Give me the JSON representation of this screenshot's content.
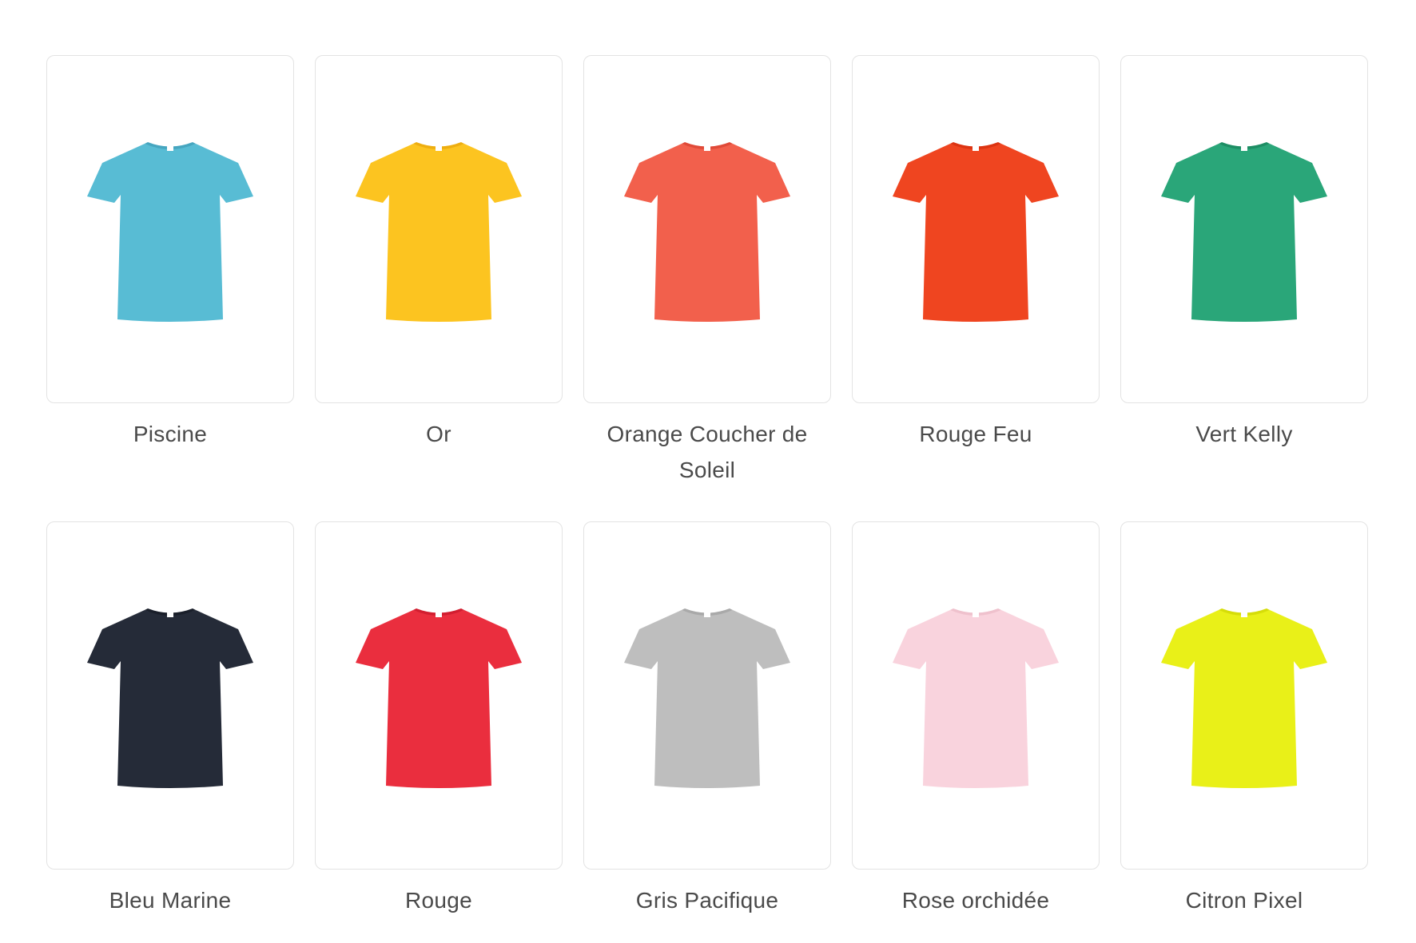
{
  "swatches": [
    {
      "label": "Piscine",
      "color": "#58bcd4",
      "shade": "#46a6c0"
    },
    {
      "label": "Or",
      "color": "#fcc420",
      "shade": "#eeae10"
    },
    {
      "label": "Orange Coucher de Soleil",
      "color": "#f2604c",
      "shade": "#e04a38"
    },
    {
      "label": "Rouge Feu",
      "color": "#ef4520",
      "shade": "#dc3412"
    },
    {
      "label": "Vert Kelly",
      "color": "#2aa679",
      "shade": "#1d8e64"
    },
    {
      "label": "Bleu Marine",
      "color": "#252b38",
      "shade": "#1a1f2a"
    },
    {
      "label": "Rouge",
      "color": "#ea2e3e",
      "shade": "#d21e30"
    },
    {
      "label": "Gris Pacifique",
      "color": "#bebebe",
      "shade": "#a9a9a9"
    },
    {
      "label": "Rose orchidée",
      "color": "#f9d3dd",
      "shade": "#efc1cd"
    },
    {
      "label": "Citron Pixel",
      "color": "#e9f018",
      "shade": "#d6dd08"
    }
  ]
}
